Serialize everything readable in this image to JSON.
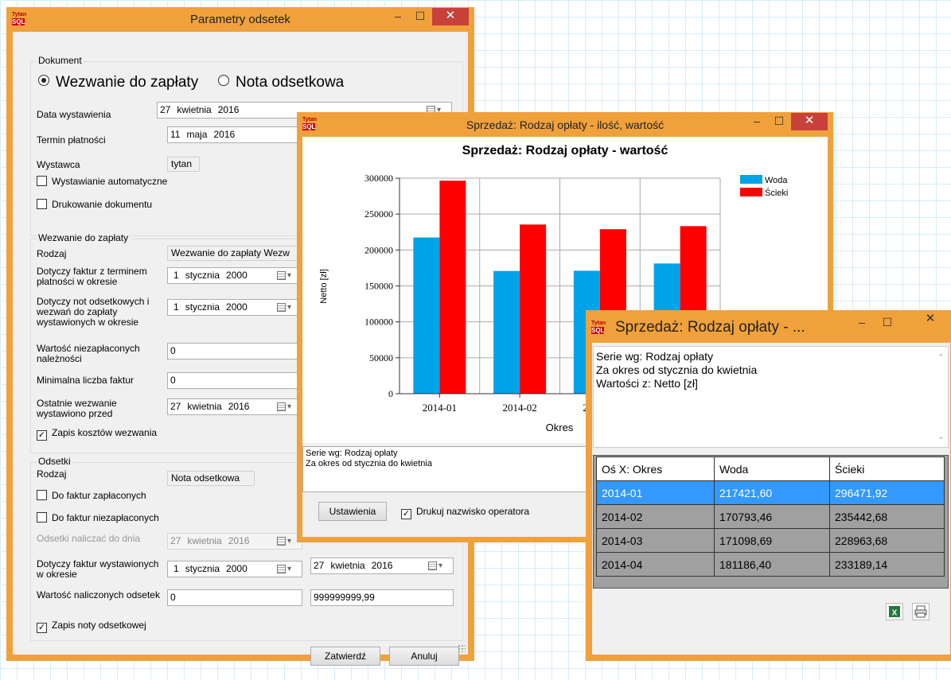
{
  "app_icon": {
    "top": "Tytan",
    "bottom": "SQL"
  },
  "win1": {
    "title": "Parametry odsetek",
    "dokument": {
      "group": "Dokument",
      "radio1": "Wezwanie do zapłaty",
      "radio2": "Nota odsetkowa",
      "data_label": "Data wystawienia",
      "data_day": "27",
      "data_month": "kwietnia",
      "data_year": "2016",
      "termin_label": "Termin płatności",
      "termin_day": "11",
      "termin_month": "maja",
      "termin_year": "2016",
      "wystawca_label": "Wystawca",
      "wystawca_value": "tytan",
      "auto_label": "Wystawianie automatyczne",
      "druk_label": "Drukowanie dokumentu"
    },
    "wezwanie": {
      "group": "Wezwanie do zapłaty",
      "rodzaj_label": "Rodzaj",
      "rodzaj_value": "Wezwanie do zapłaty Wezw",
      "faktur_label": "Dotyczy faktur z terminem płatności w okresie",
      "faktur_day": "1",
      "faktur_month": "stycznia",
      "faktur_year": "2000",
      "not_label": "Dotyczy not odsetkowych i wezwań do zapłaty wystawionych w okresie",
      "not_day": "1",
      "not_month": "stycznia",
      "not_year": "2000",
      "wartosc_label": "Wartość niezapłaconych należności",
      "wartosc_value": "0",
      "min_label": "Minimalna liczba faktur",
      "min_value": "0",
      "ostatnie_label": "Ostatnie wezwanie wystawiono przed",
      "ostatnie_day": "27",
      "ostatnie_month": "kwietnia",
      "ostatnie_year": "2016",
      "zapis_label": "Zapis kosztów wezwania"
    },
    "odsetki": {
      "group": "Odsetki",
      "rodzaj_label": "Rodzaj",
      "rodzaj_value": "Nota odsetkowa",
      "zaplac_label": "Do faktur zapłaconych",
      "niezaplac_label": "Do faktur niezapłaconych",
      "nalicz_label": "Odsetki naliczać do dnia",
      "nalicz_day": "27",
      "nalicz_month": "kwietnia",
      "nalicz_year": "2016",
      "dotyczy_label": "Dotyczy faktur wystawionych w okresie",
      "from_day": "1",
      "from_month": "stycznia",
      "from_year": "2000",
      "to_day": "27",
      "to_month": "kwietnia",
      "to_year": "2016",
      "wartosc_label": "Wartość naliczonych odsetek",
      "wartosc_from": "0",
      "wartosc_to": "999999999,99",
      "zapis_label": "Zapis noty odsetkowej"
    },
    "ok_label": "Zatwierdź",
    "cancel_label": "Anuluj"
  },
  "win2": {
    "title": "Sprzedaż: Rodzaj opłaty - ilość, wartość",
    "info_line1": "Serie wg: Rodzaj opłaty",
    "info_line2": "Za okres od stycznia do kwietnia",
    "settings_label": "Ustawienia",
    "print_operator_label": "Drukuj nazwisko operatora"
  },
  "chart_data": {
    "type": "bar",
    "title": "Sprzedaż: Rodzaj opłaty - wartość",
    "xlabel": "Okres",
    "ylabel": "Netto [zł]",
    "categories": [
      "2014-01",
      "2014-02",
      "2014-03",
      "2014-04"
    ],
    "series": [
      {
        "name": "Woda",
        "color": "#00a2e8",
        "values": [
          217421.6,
          170793.46,
          171098.69,
          181186.4
        ]
      },
      {
        "name": "Ścieki",
        "color": "#ff0000",
        "values": [
          296471.92,
          235442.68,
          228963.68,
          233189.14
        ]
      }
    ],
    "ylim": [
      0,
      300000
    ],
    "yticks": [
      "0",
      "50000",
      "100000",
      "150000",
      "200000",
      "250000",
      "300000"
    ],
    "grid": true,
    "legend": "top-right"
  },
  "win3": {
    "title": "Sprzedaż: Rodzaj opłaty - ...",
    "text_line1": "Serie wg: Rodzaj opłaty",
    "text_line2": "Za okres od stycznia do kwietnia",
    "text_line3": "Wartości z: Netto [zł]",
    "headers": [
      "Oś X: Okres",
      "Woda",
      "Ścieki"
    ],
    "rows": [
      [
        "2014-01",
        "217421,60",
        "296471,92"
      ],
      [
        "2014-02",
        "170793,46",
        "235442,68"
      ],
      [
        "2014-03",
        "171098,69",
        "228963,68"
      ],
      [
        "2014-04",
        "181186,40",
        "233189,14"
      ]
    ]
  },
  "window_buttons": {
    "min": "–",
    "max": "☐",
    "close": "✕"
  }
}
